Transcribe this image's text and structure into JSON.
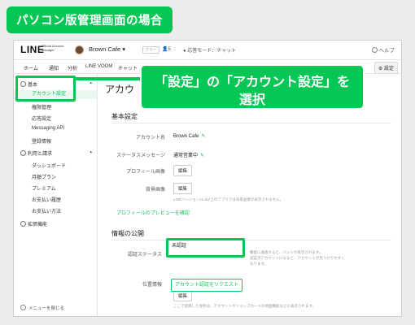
{
  "banner": "パソコン版管理画面の場合",
  "header": {
    "logo": "LINE",
    "logo_sub": "Official Account Manager",
    "account_name": "Brown Cafe",
    "plan_badge": "フリー",
    "friends": "5",
    "chat_mode": "応答モード：チャット",
    "help": "ヘルプ"
  },
  "nav": {
    "items": [
      "ホーム",
      "通知",
      "分析",
      "LINE VOOM",
      "チャット"
    ],
    "settings": "設定"
  },
  "sidebar": {
    "sections": [
      {
        "label": "基本",
        "items": [
          "アカウント設定",
          "権限管理",
          "応答設定",
          "Messaging API",
          "登録情報"
        ]
      },
      {
        "label": "利用と請求",
        "items": [
          "ダッシュボード",
          "月額プラン",
          "プレミアム",
          "お支払い履歴",
          "お支払い方法"
        ]
      },
      {
        "label": "拡張機能",
        "items": []
      }
    ],
    "collapse": "メニューを閉じる"
  },
  "main": {
    "page_title": "アカウ",
    "basic": {
      "title": "基本設定",
      "account_name_label": "アカウント名",
      "account_name_value": "Brown Cafe",
      "status_label": "ステータスメッセージ",
      "status_value": "通常営業中",
      "profile_label": "プロフィール画像",
      "edit": "編集",
      "cover_label": "背景画像",
      "cover_note": "LINEバージョン11.6以上のアプリでは背景画像が表示されません。",
      "preview_link": "プロフィールのプレビューを確認"
    },
    "publish": {
      "title": "情報の公開",
      "cert_label": "認証ステータス",
      "cert_value": "未認証",
      "request_button": "アカウント認証をリクエスト",
      "cert_note_1": "審査に通過すると、バッジが表示されます。",
      "cert_note_2": "認証済アカウントになると、アカウントが見つかりやすく",
      "cert_note_3": "なります。",
      "location_label": "位置情報",
      "location_value": "未設定",
      "location_note": "ここで登録した住所は、アカウントやショップカードの地図機能などに表示されます。"
    }
  },
  "callout": {
    "line1": "「設定」の「アカウント設定」を",
    "line2": "選択"
  },
  "colors": {
    "accent": "#06c755"
  }
}
